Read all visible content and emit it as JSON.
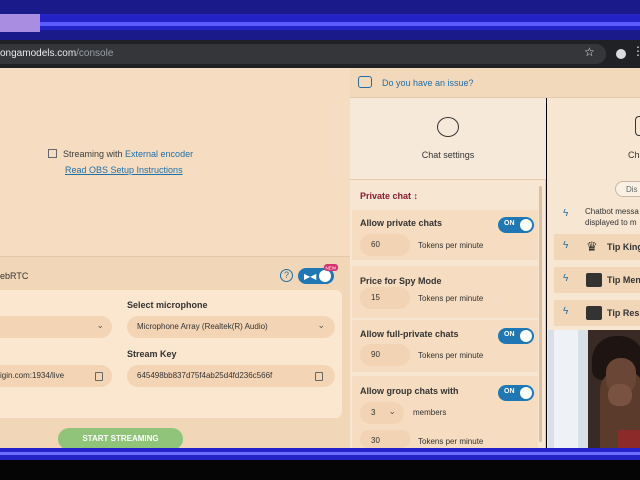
{
  "browser": {
    "url_domain": "ongamodels.com",
    "url_path": "/console"
  },
  "issue_bar": {
    "text": "Do you have an issue?"
  },
  "encoder": {
    "prefix": "Streaming with ",
    "link": "External encoder",
    "obs_link": "Read OBS Setup Instructions"
  },
  "webrtc": {
    "label": "ebRTC",
    "help": "?",
    "badge": "NEW",
    "microphone_label": "Select microphone",
    "microphone_value": "Microphone Array (Realtek(R) Audio)",
    "stream_key_label": "Stream Key",
    "server_value": "igin.com:1934/live",
    "stream_key_value": "645498bb837d75f4ab25d4fd236c566f",
    "start_button": "START STREAMING"
  },
  "chat_settings": {
    "title": "Chat settings",
    "private_chat": "Private chat",
    "allow_private": "Allow private chats",
    "private_tokens": "60",
    "tokens_per_minute": "Tokens per minute",
    "spy_label": "Price for Spy Mode",
    "spy_tokens": "15",
    "full_private_label": "Allow full-private chats",
    "full_private_tokens": "90",
    "group_label": "Allow group chats with",
    "group_members": "3",
    "members": "members",
    "group_tokens": "30",
    "on": "ON"
  },
  "right_column": {
    "title": "Cha",
    "dis": "Dis",
    "chatbot_line1": "Chatbot messa",
    "chatbot_line2": "displayed to m",
    "tip_king": "Tip King",
    "tip_menu": "Tip Men",
    "tip_resp": "Tip Resp"
  },
  "colors": {
    "accent_blue": "#1f77b4",
    "private_chat_red": "#8a1c2c",
    "start_green": "#8fc47a",
    "panel_peach": "#f6dcc0"
  }
}
